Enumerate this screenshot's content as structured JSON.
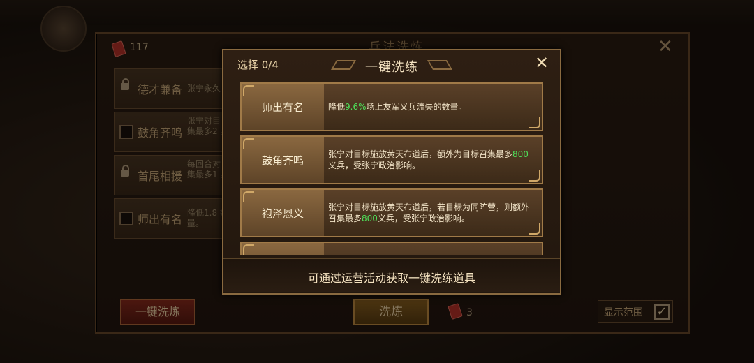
{
  "back": {
    "title": "兵法洗炼",
    "book_count": "117",
    "rows": [
      {
        "label": "德才兼备",
        "desc": "张宁永久",
        "locked": true
      },
      {
        "label": "鼓角齐鸣",
        "desc": "张宁对目 集最多2 。",
        "locked": false
      },
      {
        "label": "首尾相援",
        "desc": "每回合对 集最多1 。",
        "locked": true
      },
      {
        "label": "师出有名",
        "desc": "降低1.8 数量。",
        "locked": false
      }
    ],
    "btn_left": "一键洗炼",
    "btn_mid": "洗炼",
    "mid_count": "3",
    "range_label": "显示范围",
    "range_checked": "✓"
  },
  "dialog": {
    "select": "选择 0/4",
    "title": "一键洗练",
    "close": "✕",
    "items": [
      {
        "name": "师出有名",
        "desc_pre": "降低",
        "desc_hl": "9.6%",
        "desc_post": "场上友军义兵流失的数量。"
      },
      {
        "name": "鼓角齐鸣",
        "desc_pre": "张宁对目标施放黄天布道后，额外为目标召集最多",
        "desc_hl": "800",
        "desc_post": "义兵，受张宁政治影响。"
      },
      {
        "name": "袍泽恩义",
        "desc_pre": "张宁对目标施放黄天布道后，若目标为同阵营，则额外召集最多",
        "desc_hl": "800",
        "desc_post": "义兵，受张宁政治影响。"
      }
    ],
    "footer": "可通过运营活动获取一键洗练道具"
  },
  "colors": {
    "highlight": "#4ee05a",
    "frame": "#8a6a40",
    "accent": "#b83228"
  }
}
